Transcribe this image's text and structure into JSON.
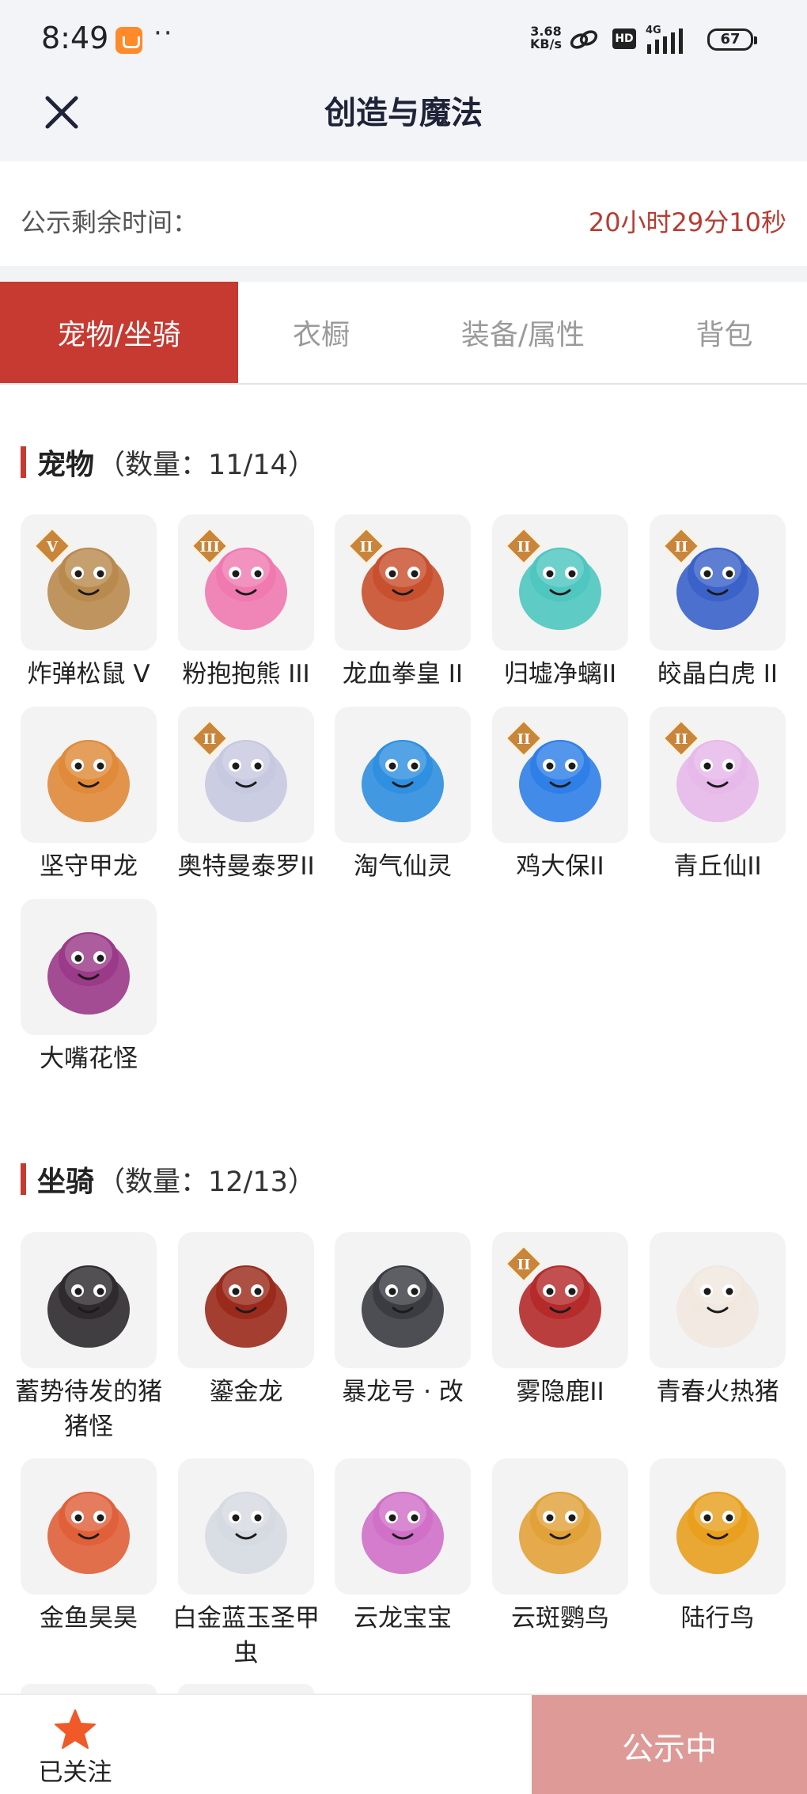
{
  "status_bar": {
    "time": "8:49",
    "dots": "··",
    "speed_value": "3.68",
    "speed_unit": "KB/s",
    "hd": "HD",
    "network": "4G",
    "battery": "67"
  },
  "header": {
    "title": "创造与魔法",
    "close_icon": "close-icon"
  },
  "notice": {
    "label": "公示剩余时间：",
    "remaining": "20小时29分10秒"
  },
  "tabs": [
    {
      "label": "宠物/坐骑",
      "active": true
    },
    {
      "label": "衣橱",
      "active": false
    },
    {
      "label": "装备/属性",
      "active": false
    },
    {
      "label": "背包",
      "active": false
    }
  ],
  "pets": {
    "name": "宠物",
    "count": "（数量：11/14）",
    "items": [
      {
        "name": "炸弹松鼠 V",
        "tier": "V",
        "color": "#b98a4e"
      },
      {
        "name": "粉抱抱熊 III",
        "tier": "III",
        "color": "#f07ab0"
      },
      {
        "name": "龙血拳皇 II",
        "tier": "II",
        "color": "#c8502e"
      },
      {
        "name": "归墟净螭II",
        "tier": "II",
        "color": "#4fc6c0"
      },
      {
        "name": "皎晶白虎 II",
        "tier": "II",
        "color": "#3a62c9"
      },
      {
        "name": "坚守甲龙",
        "tier": "",
        "color": "#e08a3a"
      },
      {
        "name": "奥特曼泰罗II",
        "tier": "II",
        "color": "#c7c9e0"
      },
      {
        "name": "淘气仙灵",
        "tier": "",
        "color": "#2f8fe0"
      },
      {
        "name": "鸡大保II",
        "tier": "II",
        "color": "#2f7fe8"
      },
      {
        "name": "青丘仙II",
        "tier": "II",
        "color": "#e7b8ea"
      },
      {
        "name": "大嘴花怪",
        "tier": "",
        "color": "#9a3a88"
      }
    ]
  },
  "mounts": {
    "name": "坐骑",
    "count": "（数量：12/13）",
    "items": [
      {
        "name": "蓄势待发的猪猪怪",
        "tier": "",
        "color": "#2e2a2e"
      },
      {
        "name": "鎏金龙",
        "tier": "",
        "color": "#9a2a1c"
      },
      {
        "name": "暴龙号 · 改",
        "tier": "",
        "color": "#3a3c42"
      },
      {
        "name": "雾隐鹿II",
        "tier": "II",
        "color": "#b52a2a"
      },
      {
        "name": "青春火热猪",
        "tier": "",
        "color": "#f1e8e0"
      },
      {
        "name": "金鱼昊昊",
        "tier": "",
        "color": "#e0603a"
      },
      {
        "name": "白金蓝玉圣甲虫",
        "tier": "",
        "color": "#d6dbe2"
      },
      {
        "name": "云龙宝宝",
        "tier": "",
        "color": "#d070c8"
      },
      {
        "name": "云斑鹦鸟",
        "tier": "",
        "color": "#e2a23a"
      },
      {
        "name": "陆行鸟",
        "tier": "",
        "color": "#e8a01e"
      }
    ]
  },
  "bottom": {
    "follow_label": "已关注",
    "status_button": "公示中"
  },
  "colors": {
    "accent": "#c63a31",
    "countdown": "#b83c32",
    "status_button": "#de9a97",
    "star": "#f05a28"
  }
}
